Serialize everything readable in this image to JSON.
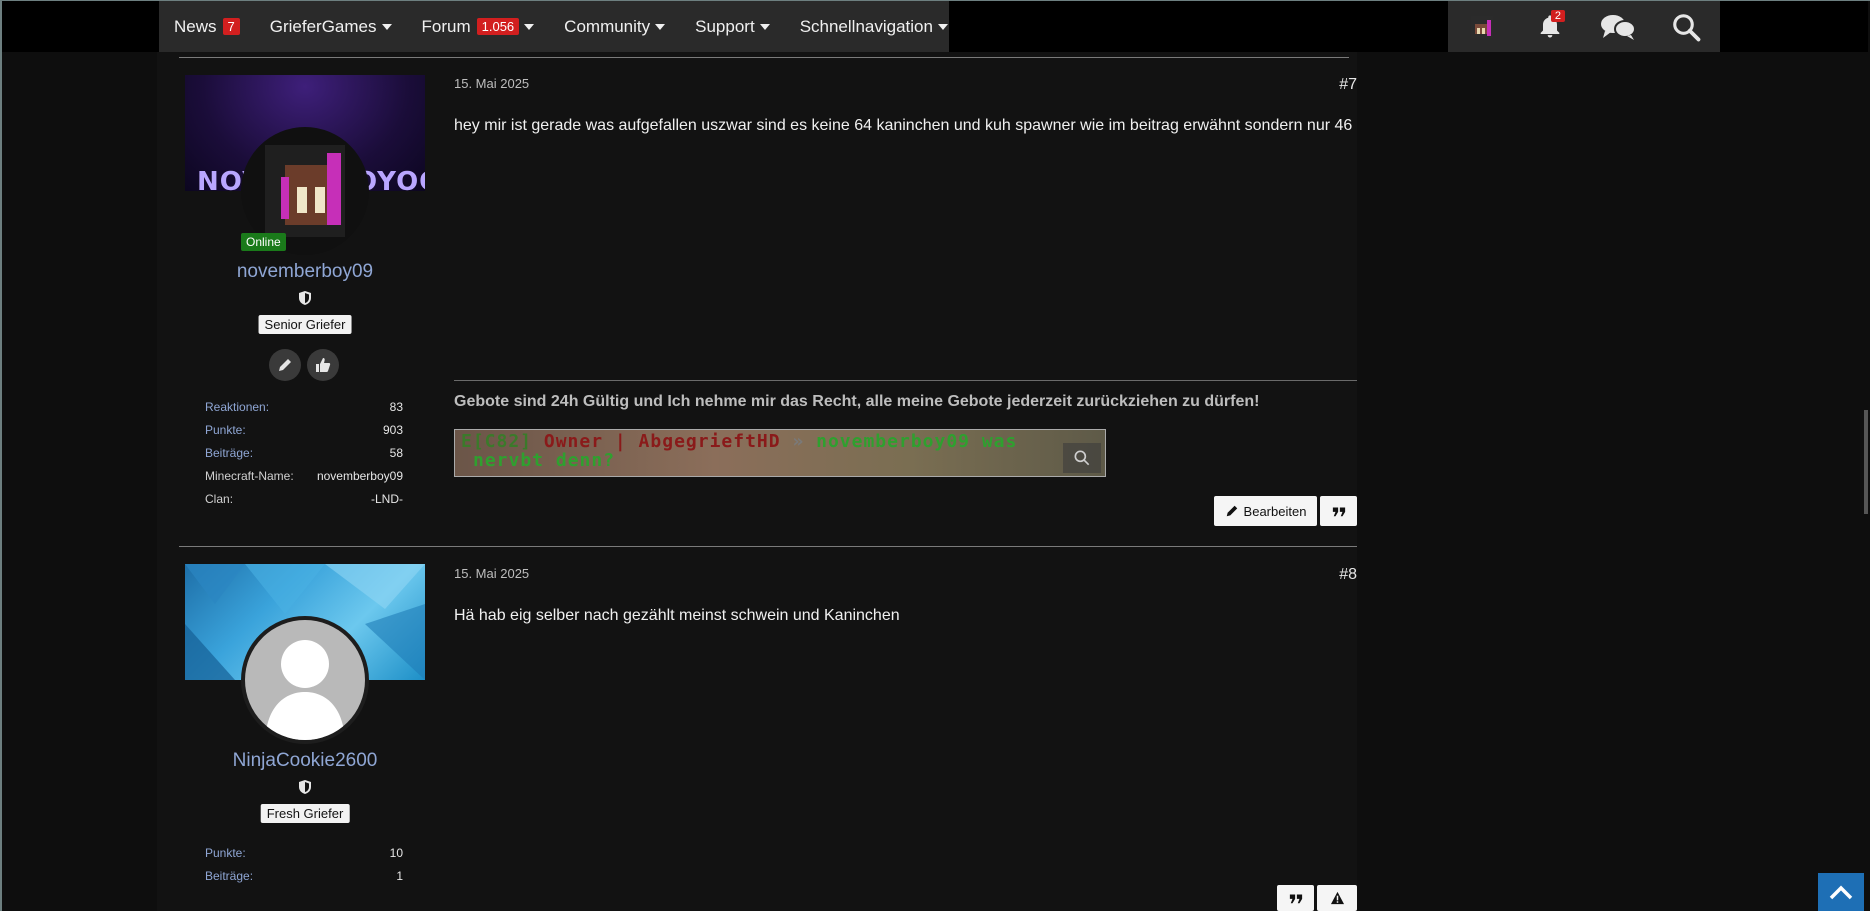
{
  "nav": {
    "items": [
      {
        "label": "News",
        "badge": "7",
        "caret": false
      },
      {
        "label": "GrieferGames",
        "badge": "",
        "caret": true
      },
      {
        "label": "Forum",
        "badge": "1.056",
        "caret": true
      },
      {
        "label": "Community",
        "badge": "",
        "caret": true
      },
      {
        "label": "Support",
        "badge": "",
        "caret": true
      },
      {
        "label": "Schnellnavigation",
        "badge": "",
        "caret": true
      }
    ],
    "notification_count": "2"
  },
  "posts": [
    {
      "number": "#7",
      "date": "15. Mai 2025",
      "message": "hey mir ist gerade was aufgefallen uszwar sind es keine 64 kaninchen und kuh spawner wie im beitrag erwähnt sondern nur 46",
      "author": {
        "name": "novemberboy09",
        "status": "Online",
        "rank": "Senior Griefer",
        "stats": [
          {
            "key": "Reaktionen",
            "value": "83"
          },
          {
            "key": "Punkte",
            "value": "903"
          },
          {
            "key": "Beiträge",
            "value": "58"
          },
          {
            "key": "Minecraft-Name",
            "value": "novemberboy09"
          },
          {
            "key": "Clan",
            "value": "-LND-"
          }
        ]
      },
      "cover_text": "NOV",
      "cover_text_right": "OYOO",
      "signature": {
        "text": "Gebote sind 24h Gültig und Ich nehme mir das Recht, alle meine Gebote jederzeit zurückziehen zu dürfen!",
        "image_line1_prefix": "E[C82] ",
        "image_line1_owner": "Owner | AbgegrieftHD",
        "image_line1_arrow": " » ",
        "image_line1_msg": "novemberboy09 was",
        "image_line2": "nervbt denn?"
      },
      "buttons": {
        "edit": "Bearbeiten"
      }
    },
    {
      "number": "#8",
      "date": "15. Mai 2025",
      "message": "Hä hab eig selber nach gezählt meinst schwein und Kaninchen",
      "author": {
        "name": "NinjaCookie2600",
        "rank": "Fresh Griefer",
        "stats": [
          {
            "key": "Punkte",
            "value": "10"
          },
          {
            "key": "Beiträge",
            "value": "1"
          }
        ]
      }
    }
  ],
  "colors": {
    "badge_red": "#d21f1f",
    "username_blue": "#8fa6d4",
    "online_green": "#1a7a1a",
    "scroll_top_blue": "#1e6fb5"
  }
}
